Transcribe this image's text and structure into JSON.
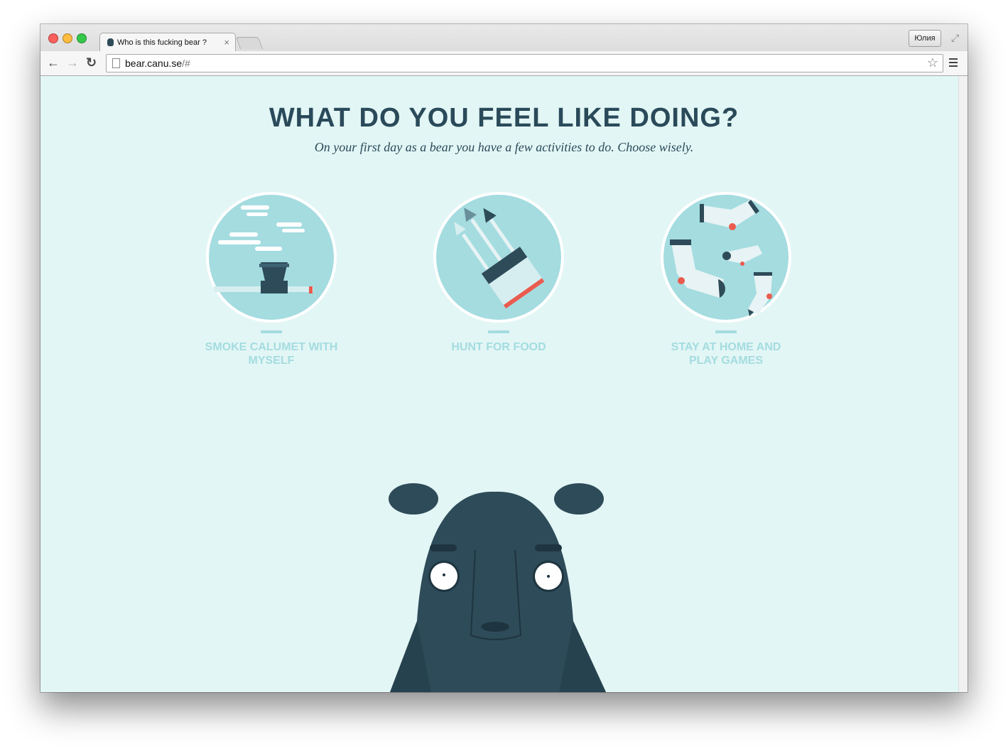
{
  "browser": {
    "tab_title": "Who is this fucking bear ?",
    "tab_close": "×",
    "profile_name": "Юлия",
    "url_host": "bear.canu.se",
    "url_path": "/#"
  },
  "page": {
    "headline": "WHAT DO YOU FEEL LIKE DOING?",
    "subtitle": "On your first day as a bear you have a few activities to do. Choose wisely.",
    "activities": [
      {
        "label": "SMOKE CALUMET WITH MYSELF",
        "icon": "calumet-pipe-icon"
      },
      {
        "label": "HUNT FOR FOOD",
        "icon": "arrows-quiver-icon"
      },
      {
        "label": "STAY AT HOME AND PLAY GAMES",
        "icon": "socks-icon"
      }
    ]
  },
  "colors": {
    "background": "#e2f6f5",
    "headline": "#2a4a5a",
    "circle": "#a4dce0",
    "label": "#a4dce0",
    "bear": "#2e4b59",
    "accent": "#ea5b4f"
  }
}
